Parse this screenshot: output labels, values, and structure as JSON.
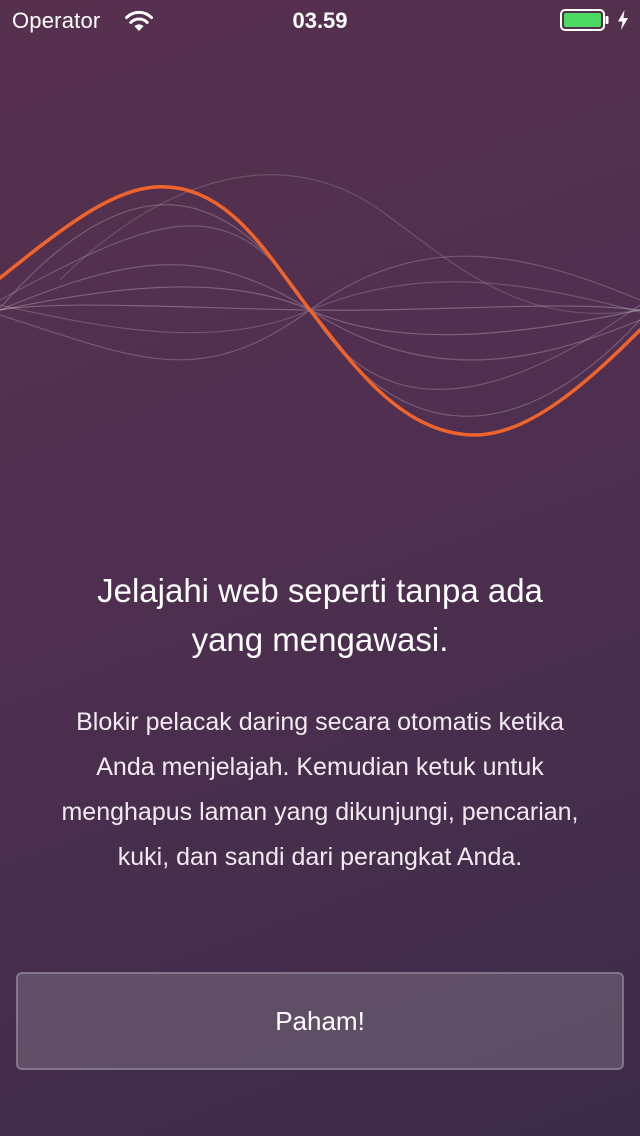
{
  "status_bar": {
    "carrier": "Operator",
    "time": "03.59",
    "wifi_icon": "wifi-icon",
    "battery_icon": "battery-icon",
    "charging_icon": "charging-bolt-icon",
    "battery_color": "#4cd964"
  },
  "illustration": {
    "icon": "sound-wave-illustration",
    "accent_color": "#f0642c"
  },
  "onboarding": {
    "headline_line1": "Jelajahi web seperti tanpa ada",
    "headline_line2": "yang mengawasi.",
    "body_line1": "Blokir pelacak daring secara otomatis ketika",
    "body_line2": "Anda menjelajah. Kemudian ketuk untuk",
    "body_line3": "menghapus laman yang dikunjungi, pencarian,",
    "body_line4": "kuki, dan sandi dari perangkat Anda.",
    "button_label": "Paham!"
  }
}
